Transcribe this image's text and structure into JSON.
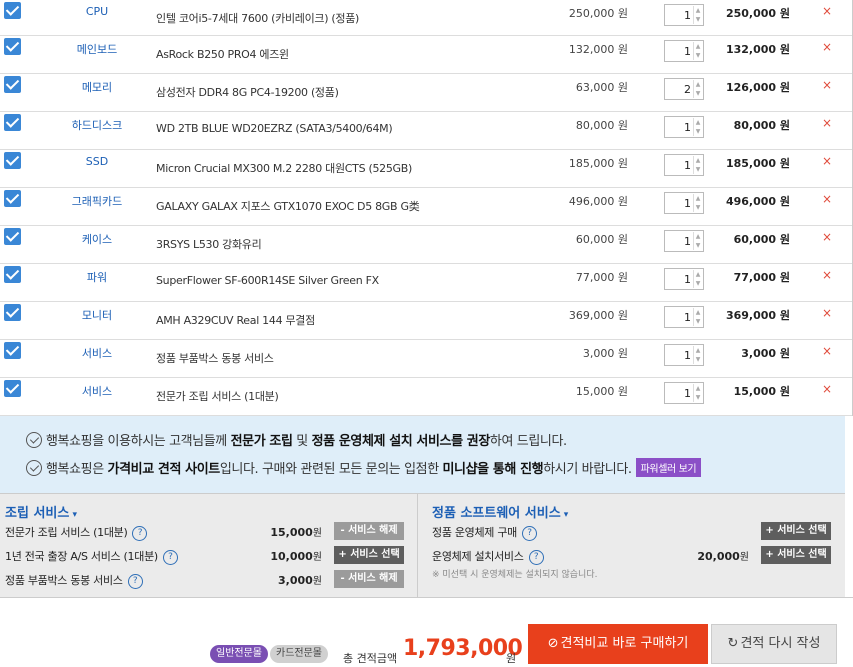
{
  "products": [
    {
      "category": "CPU",
      "name": "인텔 코어i5-7세대 7600 (카비레이크) (정품)",
      "unit_price": "250,000 원",
      "qty": "1",
      "total": "250,000 원"
    },
    {
      "category": "메인보드",
      "name": "AsRock B250 PRO4 에즈윈",
      "unit_price": "132,000 원",
      "qty": "1",
      "total": "132,000 원"
    },
    {
      "category": "메모리",
      "name": "삼성전자 DDR4 8G PC4-19200 (정품)",
      "unit_price": "63,000 원",
      "qty": "2",
      "total": "126,000 원"
    },
    {
      "category": "하드디스크",
      "name": "WD 2TB BLUE WD20EZRZ (SATA3/5400/64M)",
      "unit_price": "80,000 원",
      "qty": "1",
      "total": "80,000 원"
    },
    {
      "category": "SSD",
      "name": "Micron Crucial MX300 M.2 2280 대원CTS (525GB)",
      "unit_price": "185,000 원",
      "qty": "1",
      "total": "185,000 원"
    },
    {
      "category": "그래픽카드",
      "name": "GALAXY GALAX 지포스 GTX1070 EXOC D5 8GB G类",
      "unit_price": "496,000 원",
      "qty": "1",
      "total": "496,000 원"
    },
    {
      "category": "케이스",
      "name": "3RSYS L530 강화유리",
      "unit_price": "60,000 원",
      "qty": "1",
      "total": "60,000 원"
    },
    {
      "category": "파워",
      "name": "SuperFlower SF-600R14SE Silver Green FX",
      "unit_price": "77,000 원",
      "qty": "1",
      "total": "77,000 원"
    },
    {
      "category": "모니터",
      "name": "AMH A329CUV Real 144 무결점",
      "unit_price": "369,000 원",
      "qty": "1",
      "total": "369,000 원"
    },
    {
      "category": "서비스",
      "name": "정품 부품박스 동봉 서비스",
      "unit_price": "3,000 원",
      "qty": "1",
      "total": "3,000 원"
    },
    {
      "category": "서비스",
      "name": "전문가 조립 서비스 (1대분)",
      "unit_price": "15,000 원",
      "qty": "1",
      "total": "15,000 원"
    }
  ],
  "delete_icon": "×",
  "notice": {
    "line1_a": "행복쇼핑을 이용하시는 고객님들께 ",
    "line1_b": "전문가 조립",
    "line1_c": " 및 ",
    "line1_d": "정품 운영체제 설치 서비스를 권장",
    "line1_e": "하여 드립니다.",
    "line2_a": "행복쇼핑은 ",
    "line2_b": "가격비교 견적 사이트",
    "line2_c": "입니다. 구매와 관련된 모든 문의는 입점한 ",
    "line2_d": "미니샵을 통해 진행",
    "line2_e": "하시기 바랍니다.",
    "power_seller_btn": "파워셀러 보기"
  },
  "assembly": {
    "title": "조립 서비스",
    "items": [
      {
        "name": "전문가 조립 서비스 (1대분)",
        "price": "15,000",
        "unit": "원",
        "btn": "- 서비스 해제",
        "btn_type": "del"
      },
      {
        "name": "1년 전국 출장 A/S 서비스 (1대분)",
        "price": "10,000",
        "unit": "원",
        "btn": "+ 서비스 선택",
        "btn_type": "sel"
      },
      {
        "name": "정품 부품박스 동봉 서비스",
        "price": "3,000",
        "unit": "원",
        "btn": "- 서비스 해제",
        "btn_type": "del"
      }
    ]
  },
  "software": {
    "title": "정품 소프트웨어 서비스",
    "items": [
      {
        "name": "정품 운영체제 구매",
        "price": "",
        "unit": "",
        "btn": "+ 서비스 선택"
      },
      {
        "name": "운영체제 설치서비스",
        "price": "20,000",
        "unit": "원",
        "btn": "+ 서비스 선택"
      }
    ],
    "note": "※ 미선택 시 운영체제는 설치되지 않습니다."
  },
  "bottom": {
    "tab_general": "일반전문몰",
    "tab_card": "카드전문몰",
    "sum_label": "총 견적금액",
    "sum_value": "1,793,000",
    "sum_unit": "원",
    "buy_label": "견적비교 바로 구매하기",
    "reset_label": "견적 다시 작성"
  },
  "colors": {
    "accent": "#e8401c",
    "link": "#1c5fb5",
    "check": "#3a87d6",
    "purple": "#7a4fb3"
  }
}
